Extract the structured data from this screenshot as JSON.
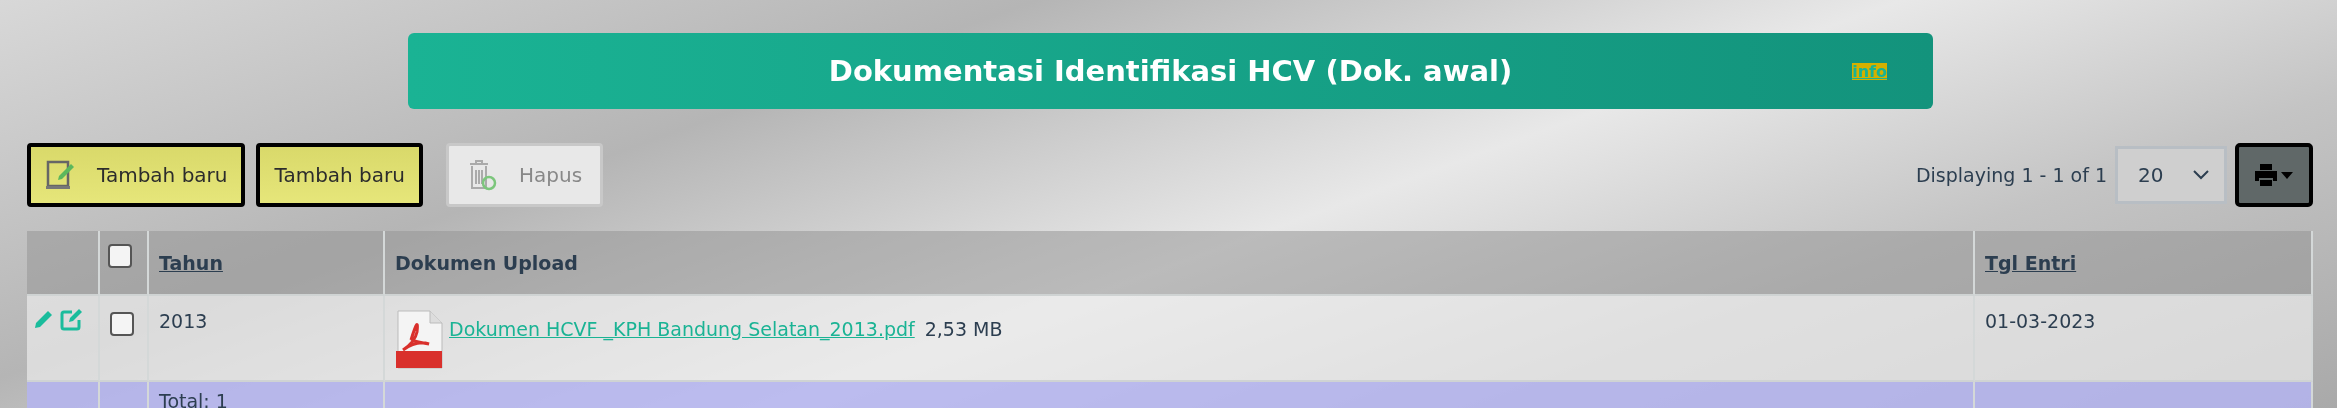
{
  "header": {
    "title": "Dokumentasi Identifikasi HCV (Dok. awal)",
    "info_link": "info"
  },
  "toolbar": {
    "buttons": [
      {
        "label": "Tambah baru",
        "kind": "add-icon",
        "disabled": false
      },
      {
        "label": "Tambah baru",
        "kind": "plain",
        "disabled": false
      },
      {
        "label": "Hapus",
        "kind": "delete-icon",
        "disabled": true
      }
    ],
    "paging_text": "Displaying 1 - 1 of 1",
    "page_size": "20"
  },
  "table": {
    "columns": [
      {
        "label": "Tahun",
        "sortable": true
      },
      {
        "label": "Dokumen Upload",
        "sortable": false
      },
      {
        "label": "Tgl Entri",
        "sortable": true
      }
    ],
    "header_checkbox": {
      "checked": false
    },
    "rows": [
      {
        "checked": false,
        "tahun": "2013",
        "file_name": "Dokumen HCVF _KPH Bandung Selatan_2013.pdf",
        "file_size": "2,53 MB",
        "tgl_entri": "01-03-2023"
      }
    ],
    "total": "Total: 1"
  }
}
